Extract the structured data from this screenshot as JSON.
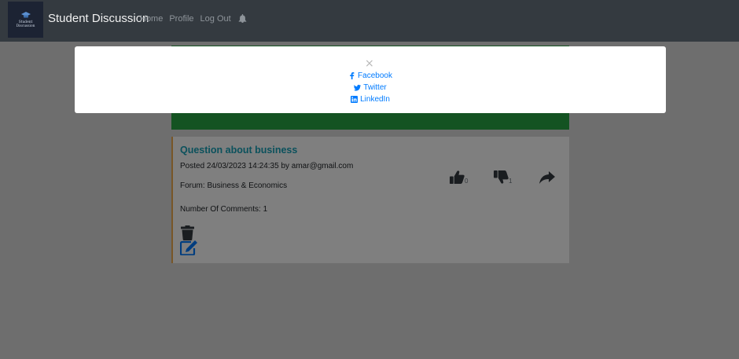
{
  "navbar": {
    "logo_lines": [
      "Student",
      "Discussion"
    ],
    "brand": "Student Discussion",
    "links": [
      "Home",
      "Profile",
      "Log Out"
    ]
  },
  "post": {
    "title": "Question about business",
    "meta": "Posted 24/03/2023 14:24:35 by amar@gmail.com",
    "forum": "Forum: Business & Economics",
    "comments": "Number Of Comments: 1",
    "likes": "0",
    "dislikes": "1"
  },
  "modal": {
    "close_glyph": "×",
    "share_options": [
      "Facebook",
      "Twitter",
      "LinkedIn"
    ]
  },
  "colors": {
    "navbar": "#343a40",
    "banner": "#28a745",
    "title": "#17a2b8",
    "link": "#007bff",
    "card_border": "#f0ad4e"
  },
  "icons": {
    "bell": "bell-icon",
    "like": "thumbs-up-icon",
    "dislike": "thumbs-down-icon",
    "share": "share-arrow-icon",
    "delete": "trash-icon",
    "edit": "edit-icon",
    "facebook": "facebook-icon",
    "twitter": "twitter-icon",
    "linkedin": "linkedin-icon"
  }
}
